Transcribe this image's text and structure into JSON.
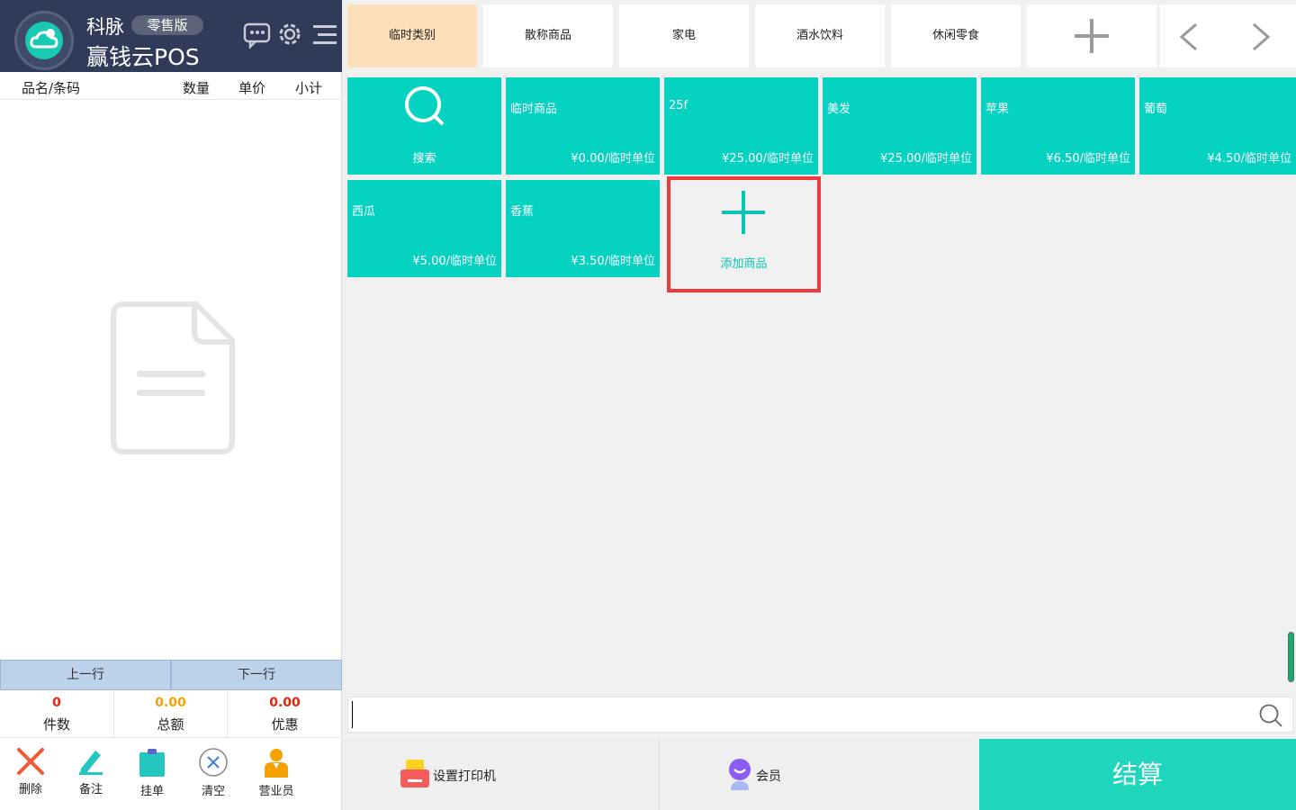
{
  "colors": {
    "brand_dark": "#2f3b58",
    "accent_teal": "#06d2c2",
    "active_tab": "#fde0b9",
    "checkout": "#1dd6bb",
    "highlight_border": "#ed3b3b",
    "total_red": "#e8240c",
    "total_orange": "#f5a200"
  },
  "header": {
    "brand": "科脉",
    "edition": "零售版",
    "product": "赢钱云POS",
    "icons": [
      "logo-cloud-icon",
      "message-icon",
      "settings-gear-icon",
      "menu-icon"
    ]
  },
  "cart": {
    "columns": [
      "品名/条码",
      "数量",
      "单价",
      "小计"
    ],
    "empty_icon": "empty-document-icon"
  },
  "row_nav": {
    "prev": "上一行",
    "next": "下一行"
  },
  "totals": [
    {
      "value": "0",
      "label": "件数"
    },
    {
      "value": "0.00",
      "label": "总额"
    },
    {
      "value": "0.00",
      "label": "优惠"
    }
  ],
  "tools": [
    {
      "label": "删除",
      "icon": "delete-x-icon"
    },
    {
      "label": "备注",
      "icon": "pen-note-icon"
    },
    {
      "label": "挂单",
      "icon": "clipboard-hold-icon"
    },
    {
      "label": "清空",
      "icon": "clear-circle-icon"
    },
    {
      "label": "营业员",
      "icon": "clerk-person-icon"
    }
  ],
  "tabs": [
    "临时类别",
    "散称商品",
    "家电",
    "酒水饮料",
    "休闲零食"
  ],
  "tab_icons": [
    "add-category-icon",
    "prev-arrow-icon",
    "next-arrow-icon"
  ],
  "tiles": {
    "search": "搜索",
    "products": [
      {
        "name": "临时商品",
        "price": "¥0.00/临时单位"
      },
      {
        "name": "25f",
        "price": "¥25.00/临时单位"
      },
      {
        "name": "美发",
        "price": "¥25.00/临时单位"
      },
      {
        "name": "苹果",
        "price": "¥6.50/临时单位"
      },
      {
        "name": "葡萄",
        "price": "¥4.50/临时单位"
      },
      {
        "name": "西瓜",
        "price": "¥5.00/临时单位"
      },
      {
        "name": "香蕉",
        "price": "¥3.50/临时单位"
      }
    ],
    "add": "添加商品"
  },
  "search": {
    "placeholder": "",
    "value": ""
  },
  "bottom": {
    "printer": "设置打印机",
    "member": "会员",
    "checkout": "结算"
  }
}
